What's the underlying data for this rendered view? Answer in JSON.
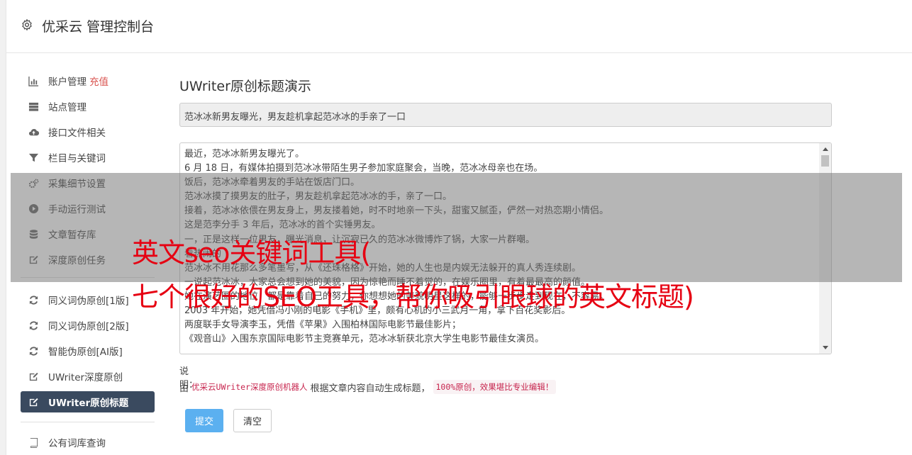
{
  "header": {
    "title": "优采云 管理控制台"
  },
  "sidebar": {
    "items": [
      {
        "label": "账户管理",
        "extra": "充值",
        "icon": "bar-chart-icon"
      },
      {
        "label": "站点管理",
        "icon": "server-icon"
      },
      {
        "label": "接口文件相关",
        "icon": "cloud-upload-icon"
      },
      {
        "label": "栏目与关键词",
        "icon": "filter-icon"
      },
      {
        "label": "采集细节设置",
        "icon": "gears-icon"
      },
      {
        "label": "手动运行测试",
        "icon": "play-circle-icon"
      },
      {
        "label": "文章暂存库",
        "icon": "database-icon"
      },
      {
        "label": "深度原创任务",
        "icon": "edit-icon"
      },
      {
        "label": "同义词伪原创[1版]",
        "icon": "refresh-icon"
      },
      {
        "label": "同义词伪原创[2版]",
        "icon": "refresh-icon"
      },
      {
        "label": "智能伪原创[AI版]",
        "icon": "refresh-icon"
      },
      {
        "label": "UWriter深度原创",
        "icon": "edit-icon"
      },
      {
        "label": "UWriter原创标题",
        "icon": "edit-icon",
        "active": true
      },
      {
        "label": "公有词库查询",
        "icon": "book-icon"
      }
    ]
  },
  "main": {
    "heading": "UWriter原创标题演示",
    "title_value": "范冰冰新男友曝光，男友趁机拿起范冰冰的手亲了一口",
    "content_lines": [
      "最近，范冰冰新男友曝光了。",
      "6 月 18 日，有媒体拍摄到范冰冰带陌生男子参加家庭聚会，当晚，范冰冰母亲也在场。",
      "饭后，范冰冰牵着男友的手站在饭店门口。",
      "范冰冰摸了摸男友的肚子，男友趁机拿起范冰冰的手，亲了一口。",
      "接着，范冰冰依偎在男友身上，男友搂着她，时不时地亲一下头，甜蜜又腻歪，俨然一对热恋期小情侣。",
      "这是范李分手 3 年后，范冰冰的首个实锤男友。",
      "一，正是这样一位男友，曝光消息，让沉寂已久的范冰冰微博炸了锅，大家一片群嘲。",
      "看热闹的",
      "范冰冰不用花那么多笔墨写，从《还珠格格》开始，她的人生也是内娱无法躲开的真人秀连续剧。",
      "一说起范冰冰，大家总会想到她的美貌，因为惊艳而睡不着觉的，在娱乐圈里，有着最最高的颜值。",
      "她在演艺圈的地位，都是靠着自己的努力，你想想她的美貌明星这样的，能够一步步走到现在，不容易。",
      "2003 年开始，她凭借冯小刚的电影《手机》里，颇有心机的小三武月一角，拿下百花奖影后。",
      "两度联手女导演李玉，凭借《苹果》入围柏林国际电影节最佳影片；",
      "《观音山》入围东京国际电影节主竞赛单元，范冰冰斩获北京大学生电影节最佳女演员。"
    ],
    "note_label": "说明：",
    "note_prefix": "由",
    "note_code1": "优采云UWriter深度原创机器人",
    "note_middle": "根据文章内容自动生成标题，",
    "note_code2": "100%原创，效果堪比专业编辑！",
    "submit_label": "提交",
    "clear_label": "清空"
  },
  "watermark": {
    "line1": "英文seo关键词工具(",
    "line2": "七个很好的SEO工具，帮你吸引眼球的英文标题)"
  },
  "colors": {
    "accent": "#5bb0f0",
    "active_nav": "#3a4a5f",
    "watermark": "#e60012",
    "code": "#c7254e"
  }
}
